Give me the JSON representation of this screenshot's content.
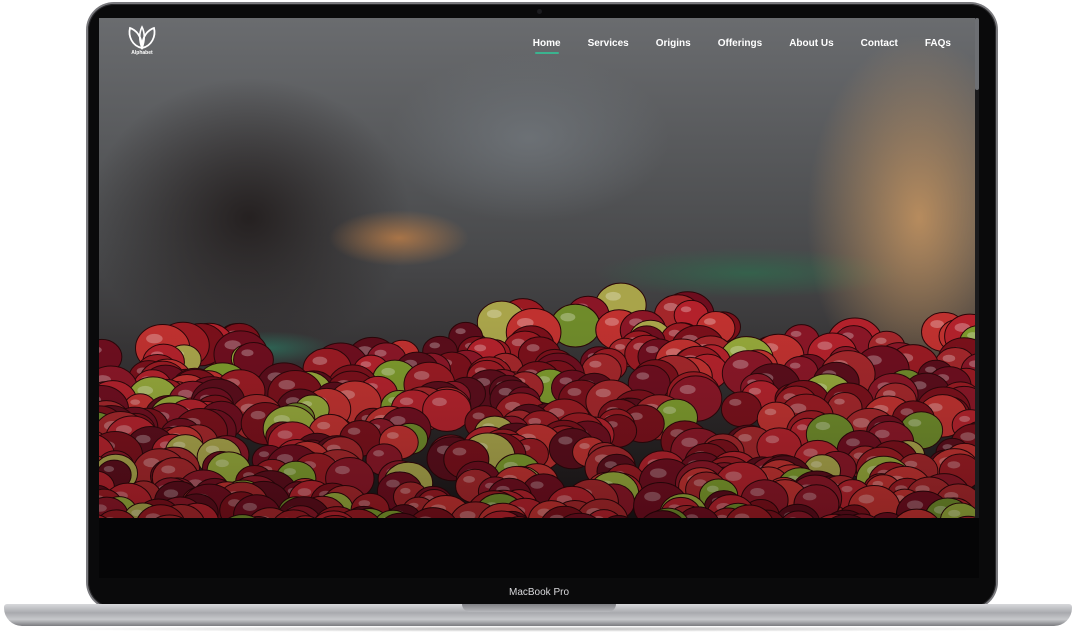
{
  "brand": {
    "logo_text": "Alphabet"
  },
  "nav": {
    "items": [
      {
        "label": "Home",
        "active": true
      },
      {
        "label": "Services",
        "active": false
      },
      {
        "label": "Origins",
        "active": false
      },
      {
        "label": "Offerings",
        "active": false
      },
      {
        "label": "About Us",
        "active": false
      },
      {
        "label": "Contact",
        "active": false
      },
      {
        "label": "FAQs",
        "active": false
      }
    ]
  },
  "device": {
    "model_label": "MacBook Pro"
  },
  "colors": {
    "accent": "#3bb38f",
    "bezel": "#0a0a0b"
  }
}
